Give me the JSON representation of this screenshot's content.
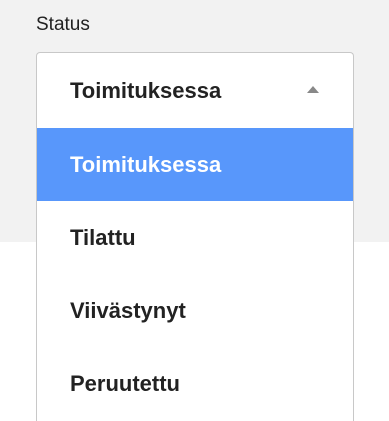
{
  "field": {
    "label": "Status"
  },
  "select": {
    "selected_value": "Toimituksessa",
    "caret_icon": "caret-up-icon",
    "highlight_color": "#5897fb"
  },
  "options": [
    {
      "label": "Toimituksessa",
      "highlighted": true
    },
    {
      "label": "Tilattu",
      "highlighted": false
    },
    {
      "label": "Viivästynyt",
      "highlighted": false
    },
    {
      "label": "Peruutettu",
      "highlighted": false
    }
  ]
}
